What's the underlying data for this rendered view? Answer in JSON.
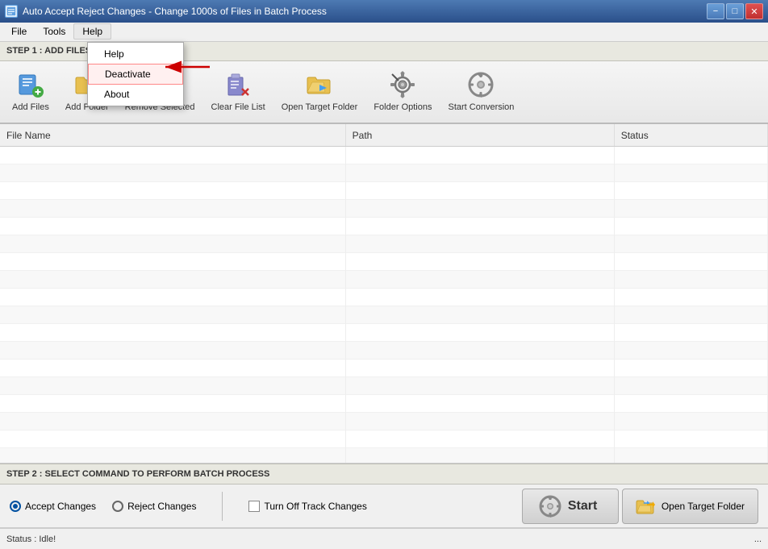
{
  "titleBar": {
    "title": "Auto Accept Reject Changes - Change 1000s of Files in Batch Process",
    "icon": "A"
  },
  "menuBar": {
    "items": [
      {
        "id": "file",
        "label": "File"
      },
      {
        "id": "tools",
        "label": "Tools"
      },
      {
        "id": "help",
        "label": "Help"
      }
    ]
  },
  "helpMenu": {
    "items": [
      {
        "id": "help",
        "label": "Help"
      },
      {
        "id": "deactivate",
        "label": "Deactivate"
      },
      {
        "id": "about",
        "label": "About"
      }
    ]
  },
  "step1": {
    "label": "STEP 1 : ADD FILES (DOC, DOCX, RTF)"
  },
  "toolbar": {
    "buttons": [
      {
        "id": "add-files",
        "label": "Add Files"
      },
      {
        "id": "add-folder",
        "label": "Add Folder"
      },
      {
        "id": "remove-selected",
        "label": "Remove Selected"
      },
      {
        "id": "clear-file-list",
        "label": "Clear File List"
      },
      {
        "id": "open-target-folder",
        "label": "Open Target Folder"
      },
      {
        "id": "folder-options",
        "label": "Folder Options"
      },
      {
        "id": "start-conversion",
        "label": "Start Conversion"
      }
    ]
  },
  "fileTable": {
    "columns": [
      {
        "id": "file-name",
        "label": "File Name"
      },
      {
        "id": "path",
        "label": "Path"
      },
      {
        "id": "status",
        "label": "Status"
      }
    ],
    "rows": []
  },
  "step2": {
    "label": "STEP 2 : SELECT COMMAND TO PERFORM BATCH PROCESS"
  },
  "bottomControls": {
    "acceptChanges": "Accept Changes",
    "rejectChanges": "Reject Changes",
    "turnOffTrackChanges": "Turn Off Track Changes",
    "startLabel": "Start",
    "openTargetFolderLabel": "Open Target Folder"
  },
  "statusBar": {
    "status": "Status : Idle!"
  },
  "colors": {
    "accent": "#0050a0",
    "red": "#cc0000",
    "gearGray": "#888888"
  }
}
